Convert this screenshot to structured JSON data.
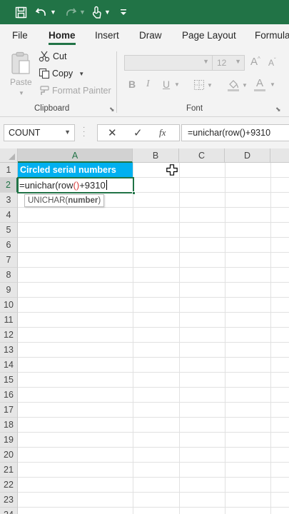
{
  "quick_access": {
    "icons": [
      "save-icon",
      "undo-icon",
      "redo-icon",
      "touch-mode-icon",
      "customize-icon"
    ]
  },
  "tabs": [
    "File",
    "Home",
    "Insert",
    "Draw",
    "Page Layout",
    "Formula"
  ],
  "active_tab": "Home",
  "clipboard": {
    "paste_label": "Paste",
    "cut_label": "Cut",
    "copy_label": "Copy",
    "format_painter_label": "Format Painter",
    "group_label": "Clipboard"
  },
  "font": {
    "font_name": "",
    "font_size": "12",
    "bold_label": "B",
    "italic_label": "I",
    "underline_label": "U",
    "font_color_label": "A",
    "group_label": "Font"
  },
  "formula_bar": {
    "name_box": "COUNT",
    "cancel_label": "✕",
    "enter_label": "✓",
    "fx_label": "fx",
    "formula": "=unichar(row()+9310"
  },
  "grid": {
    "columns": [
      "A",
      "B",
      "C",
      "D"
    ],
    "selected_column": "A",
    "rows": [
      "1",
      "2",
      "3",
      "4",
      "5",
      "6",
      "7",
      "8",
      "9",
      "10",
      "11",
      "12",
      "13",
      "14",
      "15",
      "16",
      "17",
      "18",
      "19",
      "20",
      "21",
      "22",
      "23",
      "24"
    ],
    "selected_row": "2",
    "cells": {
      "A1": "Circled serial numbers",
      "A2_prefix": "=unichar(row",
      "A2_parens": "()",
      "A2_suffix": "+9310"
    },
    "header_fill_color": "#00b0f0",
    "accent_color": "#217346"
  },
  "tooltip": {
    "function_name": "UNICHAR(",
    "arg": "number",
    "close": ")"
  }
}
